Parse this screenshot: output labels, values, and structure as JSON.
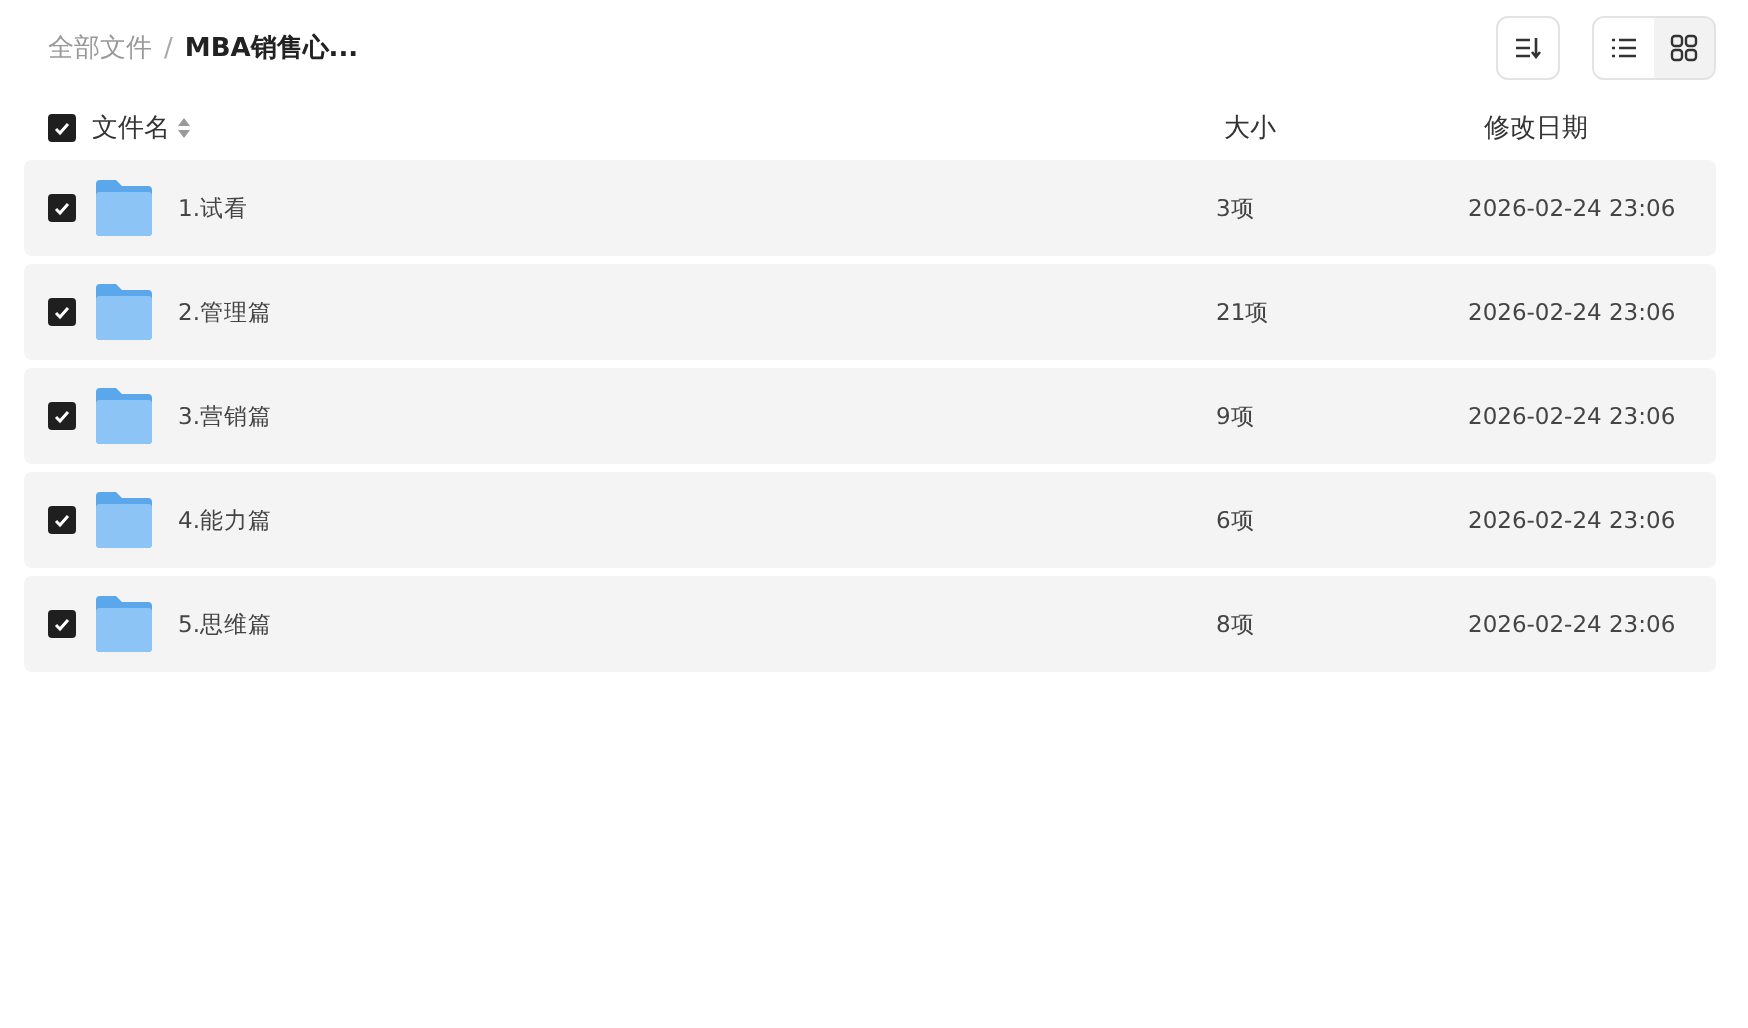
{
  "breadcrumb_separator": "/",
  "breadcrumb": [
    {
      "label": "全部文件",
      "current": false
    },
    {
      "label": "MBA销售心...",
      "current": true
    }
  ],
  "view_toggle": [
    {
      "kind": "list",
      "selected": true
    },
    {
      "kind": "grid",
      "selected": false
    }
  ],
  "table": {
    "select_all": {
      "checked": true
    },
    "columns": [
      "文件名",
      "大小",
      "修改日期"
    ],
    "rows": [
      {
        "checked": true,
        "name": "1.试看",
        "size": "3项",
        "modified": "2026-02-24 23:06"
      },
      {
        "checked": true,
        "name": "2.管理篇",
        "size": "21项",
        "modified": "2026-02-24 23:06"
      },
      {
        "checked": true,
        "name": "3.营销篇",
        "size": "9项",
        "modified": "2026-02-24 23:06"
      },
      {
        "checked": true,
        "name": "4.能力篇",
        "size": "6项",
        "modified": "2026-02-24 23:06"
      },
      {
        "checked": true,
        "name": "5.思维篇",
        "size": "8项",
        "modified": "2026-02-24 23:06"
      }
    ]
  }
}
